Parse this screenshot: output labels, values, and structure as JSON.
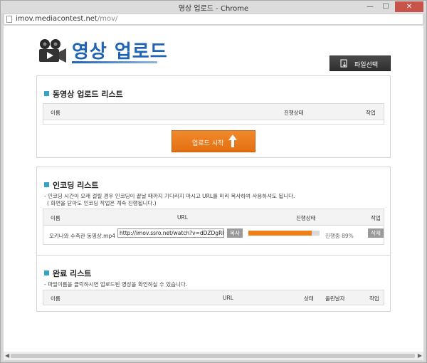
{
  "window": {
    "title": "영상 업로드 - Chrome",
    "min": "—",
    "max": "☐",
    "close": "✕"
  },
  "address": {
    "host": "imov.mediacontest.net",
    "path": "/mov/"
  },
  "header": {
    "title": "영상 업로드",
    "file_select_label": "파일선택"
  },
  "upload_panel": {
    "title": "동영상 업로드 리스트",
    "columns": [
      "이름",
      "진행상태",
      "작업"
    ],
    "start_button": "업로드 시작"
  },
  "encoding_panel": {
    "title": "인코딩 리스트",
    "desc1": "- 인코딩 시간이 오래 걸릴 경우 인코딩이 끝날 때까지 기다리지 마시고 URL를 미리 복사하여 사용하셔도 됩니다.",
    "desc2": "( 화면을 닫아도 인코딩 작업은 계속 진행됩니다.)",
    "columns": [
      "이름",
      "URL",
      "진행상태",
      "작업"
    ],
    "row": {
      "name": "오키나와 수족관 동영상.mp4",
      "url": "http://imov.ssro.net/watch?v=dDZDgRkbTnv",
      "copy": "복사",
      "progress": 89,
      "status": "진행중 89%",
      "delete": "삭제"
    }
  },
  "done_panel": {
    "title": "완료 리스트",
    "desc": "- 파일이름을 클릭하시면 업로드된 영상을 확인하실 수 있습니다.",
    "columns": [
      "이름",
      "URL",
      "상태",
      "올린날자",
      "작업"
    ]
  },
  "colors": {
    "accent": "#36a4c6",
    "orange": "#f07f1a",
    "title_blue": "#1e63b4"
  }
}
